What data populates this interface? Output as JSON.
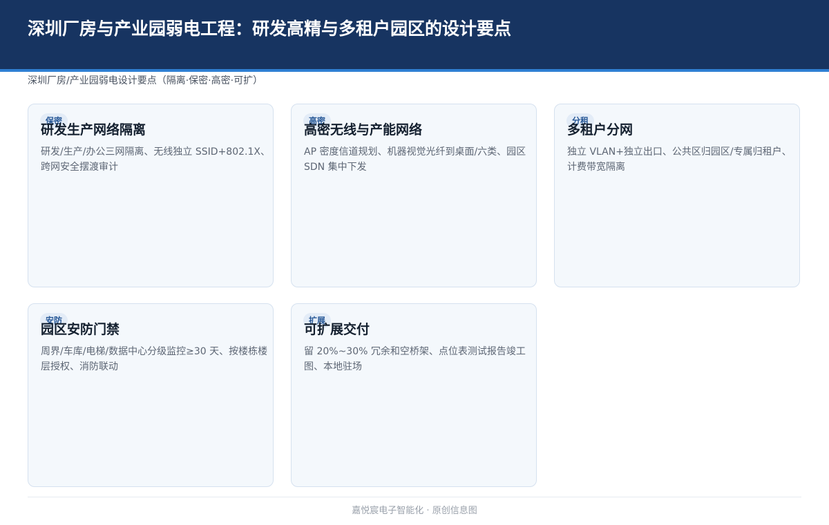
{
  "header": {
    "title": "深圳厂房与产业园弱电工程：研发高精与多租户园区的设计要点"
  },
  "subtitle": "深圳厂房/产业园弱电设计要点（隔离·保密·高密·可扩）",
  "cards": [
    {
      "tag": "保密",
      "title": "研发生产网络隔离",
      "desc": "研发/生产/办公三网隔离、无线独立 SSID+802.1X、跨网安全摆渡审计"
    },
    {
      "tag": "高密",
      "title": "高密无线与产能网络",
      "desc": "AP 密度信道规划、机器视觉光纤到桌面/六类、园区 SDN 集中下发"
    },
    {
      "tag": "分租",
      "title": "多租户分网",
      "desc": "独立 VLAN+独立出口、公共区归园区/专属归租户、计费带宽隔离"
    },
    {
      "tag": "安防",
      "title": "园区安防门禁",
      "desc": "周界/车库/电梯/数据中心分级监控≥30 天、按楼栋楼层授权、消防联动"
    },
    {
      "tag": "扩展",
      "title": "可扩展交付",
      "desc": "留 20%~30% 冗余和空桥架、点位表测试报告竣工图、本地驻场"
    }
  ],
  "footer": "嘉悦宸电子智能化 · 原创信息图"
}
